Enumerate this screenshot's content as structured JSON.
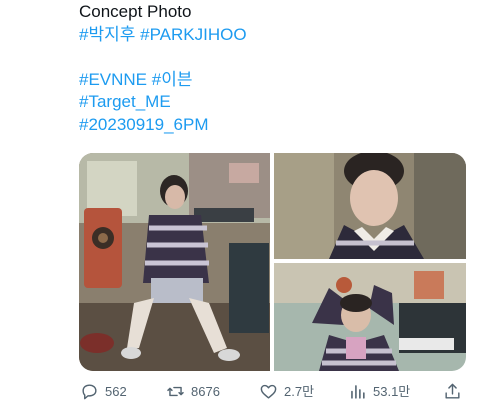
{
  "tweet": {
    "line1": "Concept Photo",
    "line2_tags": [
      "#박지후",
      "#PARKJIHOO"
    ],
    "line3_tags": [
      "#EVNNE",
      "#이븐"
    ],
    "line4_tag": "#Target_ME",
    "line5_tag": "#20230919_6PM"
  },
  "media": {
    "photos": [
      {
        "subject": "photo-1-left"
      },
      {
        "subject": "photo-2-top-right"
      },
      {
        "subject": "photo-3-bottom-right"
      }
    ]
  },
  "actions": {
    "reply_count": "562",
    "retweet_count": "8676",
    "like_count": "2.7만",
    "view_count": "53.1만",
    "icons": [
      "reply-icon",
      "retweet-icon",
      "like-icon",
      "views-icon",
      "share-icon"
    ]
  },
  "colors": {
    "text": "#0f1419",
    "hashtag": "#1d9bf0",
    "muted": "#536471"
  }
}
